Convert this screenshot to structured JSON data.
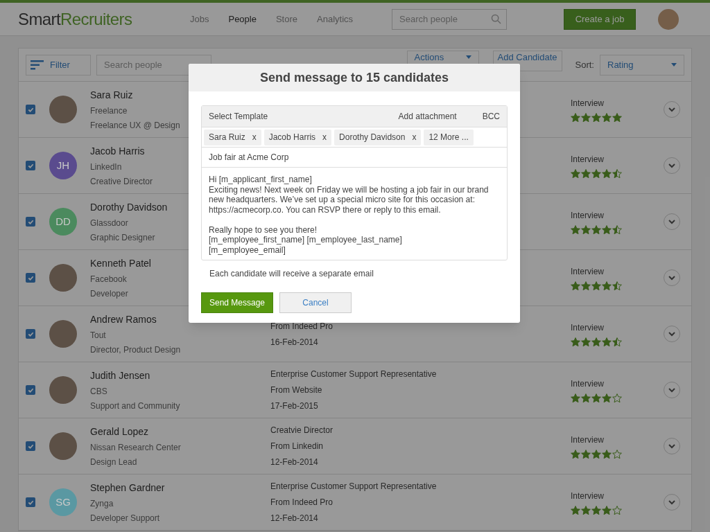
{
  "header": {
    "logo": [
      "Smart",
      "Recruiters"
    ],
    "nav": [
      {
        "label": "Jobs",
        "selected": false
      },
      {
        "label": "People",
        "selected": true
      },
      {
        "label": "Store",
        "selected": false
      },
      {
        "label": "Analytics",
        "selected": false
      }
    ],
    "search": {
      "placeholder": "Search people"
    },
    "create_button": "Create a job"
  },
  "toolbar": {
    "filter": "Filter",
    "search": {
      "placeholder": "Search people"
    },
    "actions": "Actions",
    "add_candidate": "Add Candidate",
    "sort_label": "Sort:",
    "sort_value": "Rating"
  },
  "candidates": [
    {
      "name": "Sara Ruiz",
      "source": "Freelance",
      "title": "Freelance UX @ Design",
      "checked": true,
      "avatar": {
        "kind": "photo"
      },
      "status": "Interview",
      "stars": 5
    },
    {
      "name": "Jacob Harris",
      "source": "LinkedIn",
      "title": "Creative Director",
      "checked": true,
      "avatar": {
        "kind": "initials",
        "initials": "JH",
        "color": "#5a4b8e"
      },
      "status": "Interview",
      "stars": 4.5
    },
    {
      "name": "Dorothy Davidson",
      "source": "Glassdoor",
      "title": "Graphic Designer",
      "checked": true,
      "avatar": {
        "kind": "initials",
        "initials": "DD",
        "color": "#4b8a5e"
      },
      "status": "Interview",
      "stars": 4.5
    },
    {
      "name": "Kenneth Patel",
      "source": "Facebook",
      "title": "Developer",
      "checked": true,
      "avatar": {
        "kind": "photo"
      },
      "status": "Interview",
      "stars": 4.5
    },
    {
      "name": "Andrew Ramos",
      "source": "Tout",
      "title": "Director, Product Design",
      "checked": true,
      "avatar": {
        "kind": "photo"
      },
      "origin": "From Indeed Pro",
      "date": "16-Feb-2014",
      "status": "Interview",
      "stars": 4.5
    },
    {
      "name": "Judith Jensen",
      "source": "CBS",
      "title": "Support and Community",
      "checked": true,
      "avatar": {
        "kind": "photo"
      },
      "job": "Enterprise Customer Support Representative",
      "origin": "From Website",
      "date": "17-Feb-2015",
      "status": "Interview",
      "stars": 4
    },
    {
      "name": "Gerald Lopez",
      "source": "Nissan Research Center",
      "title": "Design Lead",
      "checked": true,
      "avatar": {
        "kind": "photo"
      },
      "job": "Creatvie Director",
      "origin": "From Linkedin",
      "date": "12-Feb-2014",
      "status": "Interview",
      "stars": 4
    },
    {
      "name": "Stephen Gardner",
      "source": "Zynga",
      "title": "Developer Support",
      "checked": true,
      "avatar": {
        "kind": "initials",
        "initials": "SG",
        "color": "#5a98a2"
      },
      "job": "Enterprise Customer Support Representative",
      "origin": "From Indeed Pro",
      "date": "12-Feb-2014",
      "status": "Interview",
      "stars": 4
    }
  ],
  "dialog": {
    "title": "Send message to 15 candidates",
    "template": "Select Template",
    "attachment": "Add attachment",
    "bcc": "BCC",
    "recipients": [
      {
        "label": "Sara Ruiz",
        "remove": "x"
      },
      {
        "label": "Jacob Harris",
        "remove": "x"
      },
      {
        "label": "Dorothy Davidson",
        "remove": "x"
      }
    ],
    "more": "12 More ...",
    "subject": "Job fair at Acme Corp",
    "body": "Hi [m_applicant_first_name]\nExciting news! Next week on Friday we will be hosting a job fair in our brand new headquarters. We’ve set up a special micro site for this occasion at: https://acmecorp.co. You can RSVP there or reply to this email.\n\nReally hope to see you there!\n[m_employee_first_name] [m_employee_last_name]\n[m_employee_email]",
    "note": "Each candidate will receive a separate email",
    "send": "Send Message",
    "cancel": "Cancel"
  }
}
